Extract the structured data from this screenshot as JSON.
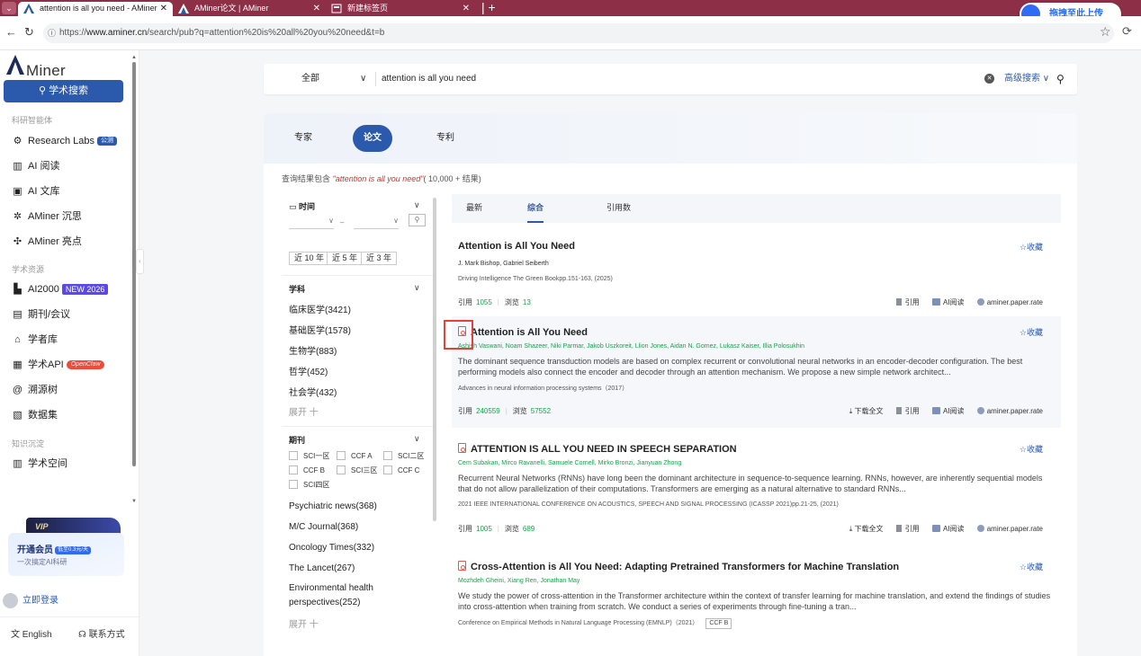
{
  "browser": {
    "tabs": [
      {
        "title": "attention is all you need - AMiner",
        "active": true
      },
      {
        "title": "AMiner论文 | AMiner",
        "active": false
      },
      {
        "title": "新建标签页",
        "active": false
      }
    ],
    "url_prefix": "https://",
    "url_host": "www.aminer.cn",
    "url_path": "/search/pub?q=attention%20is%20all%20you%20need&t=b",
    "baidu_upload_label": "拖拽至此上传"
  },
  "sidebar": {
    "logo_text": "Miner",
    "search_button": "学术搜索",
    "section_ai": "科研智能体",
    "research_labs": "Research Labs",
    "research_labs_badge": "公测",
    "ai_read": "AI 阅读",
    "ai_library": "AI 文库",
    "aminer_think": "AMiner 沉思",
    "aminer_highlight": "AMiner 亮点",
    "section_resources": "学术资源",
    "ai2000": "AI2000",
    "ai2000_badge": "NEW 2026",
    "journals": "期刊/会议",
    "scholars": "学者库",
    "api": "学术API",
    "api_badge": "OpenClaw",
    "trace_tree": "溯源树",
    "datasets": "数据集",
    "section_knowledge": "知识沉淀",
    "academic_space": "学术空间",
    "vip_tag": "VIP",
    "vip_title": "开通会员",
    "vip_price": "低至0.3元/天",
    "vip_sub": "一次搞定AI科研",
    "login": "立即登录",
    "language": "English",
    "contact": "联系方式"
  },
  "search": {
    "scope": "全部",
    "query": "attention is all you need",
    "advanced": "高级搜索"
  },
  "type_tabs": {
    "expert": "专家",
    "paper": "论文",
    "patent": "专利"
  },
  "summary": {
    "prefix": "查询结果包含 ",
    "query": "\"attention is all you need\"",
    "suffix": "( 10,000 + 结果)"
  },
  "filters": {
    "time_label": "时间",
    "year_dash": "–",
    "year_buttons": [
      "近 10 年",
      "近 5 年",
      "近 3 年"
    ],
    "subject_label": "学科",
    "subjects": [
      "临床医学(3421)",
      "基础医学(1578)",
      "生物学(883)",
      "哲学(452)",
      "社会学(432)"
    ],
    "more": "展开 十",
    "journal_label": "期刊",
    "journal_checks": [
      "SCI一区",
      "CCF A",
      "SCI二区",
      "CCF B",
      "SCI三区",
      "CCF C",
      "SCI四区"
    ],
    "journals": [
      "Psychiatric news(368)",
      "M/C Journal(368)",
      "Oncology Times(332)",
      "The Lancet(267)",
      "Environmental health",
      "perspectives(252)"
    ]
  },
  "sort": {
    "latest": "最新",
    "overall": "综合",
    "citations": "引用数"
  },
  "common_labels": {
    "favorite": "☆收藏",
    "cite_prefix": "引用",
    "view_prefix": "浏览",
    "download": "下载全文",
    "cite_action": "引用",
    "ai_read": "AI阅读",
    "rate": "aminer.paper.rate"
  },
  "results": [
    {
      "title": "Attention is All You Need",
      "has_pdf": false,
      "authors": "J. Mark Bishop,  Gabriel Seiberth",
      "venue": "Driving Intelligence The Green Bookpp.151-163, (2025)",
      "abstract": "",
      "citations": "1055",
      "views": "13"
    },
    {
      "title": "Attention is All You Need",
      "has_pdf": true,
      "authors": "Ashish Vaswani,  Noam Shazeer,  Niki Parmar,  Jakob Uszkoreit,  Llion Jones,  Aidan N. Gomez,  Lukasz Kaiser,  Illia Polosukhin",
      "venue": "Advances in neural information processing systems（2017）",
      "abstract": "The dominant sequence transduction models are based on complex recurrent or convolutional neural networks in an encoder-decoder configuration. The best performing models also connect the encoder and decoder through an attention mechanism. We propose a new simple network architect...",
      "citations": "240559",
      "views": "57552"
    },
    {
      "title": "ATTENTION IS ALL YOU NEED IN SPEECH SEPARATION",
      "has_pdf": true,
      "authors": "Cem Subakan,  Mirco Ravanelli,  Samuele Cornell,  Mirko Bronzi,  Jianyuan Zhong",
      "venue": "2021 IEEE INTERNATIONAL CONFERENCE ON ACOUSTICS, SPEECH AND SIGNAL PROCESSING (ICASSP 2021)pp.21-25, (2021)",
      "abstract": "Recurrent Neural Networks (RNNs) have long been the dominant architecture in sequence-to-sequence learning. RNNs, however, are inherently sequential models that do not allow parallelization of their computations. Transformers are emerging as a natural alternative to standard RNNs...",
      "citations": "1005",
      "views": "689"
    },
    {
      "title": "Cross-Attention is All You Need: Adapting Pretrained Transformers for Machine Translation",
      "has_pdf": true,
      "authors": "Mozhdeh Gheini,  Xiang Ren,  Jonathan May",
      "venue": "Conference on Empirical Methods in Natural Language Processing (EMNLP)（2021）",
      "venue_tag": "CCF B",
      "abstract": "We study the power of cross-attention in the Transformer architecture within the context of transfer learning for machine translation, and extend the findings of studies into cross-attention when training from scratch. We conduct a series of experiments through fine-tuning a tran..."
    }
  ],
  "colors": {
    "brand": "#2b5aad",
    "tab_strip": "#8e2f48",
    "green_num": "#16a34a",
    "highlight_box": "#e3423b"
  }
}
